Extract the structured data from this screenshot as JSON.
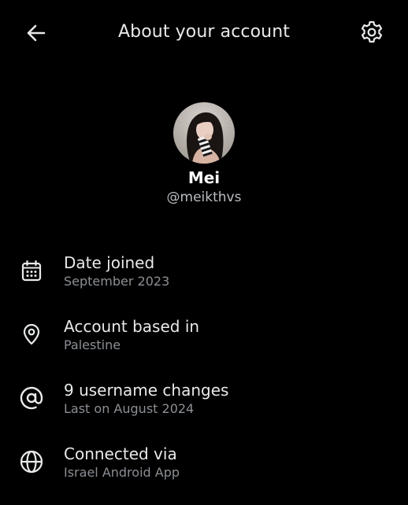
{
  "header": {
    "title": "About your account",
    "back_icon": "arrow-left-icon",
    "settings_icon": "gear-icon"
  },
  "profile": {
    "display_name": "Mei",
    "handle": "@meikthvs",
    "avatar": "profile-photo"
  },
  "rows": [
    {
      "icon": "calendar-icon",
      "label": "Date joined",
      "value": "September 2023"
    },
    {
      "icon": "location-pin-icon",
      "label": "Account based in",
      "value": "Palestine"
    },
    {
      "icon": "at-sign-icon",
      "label": "9 username changes",
      "value": "Last on August 2024"
    },
    {
      "icon": "globe-icon",
      "label": "Connected via",
      "value": "Israel Android App"
    }
  ],
  "colors": {
    "background": "#000000",
    "primary_text": "#e7e9ea",
    "secondary_text": "#8b8f94"
  }
}
